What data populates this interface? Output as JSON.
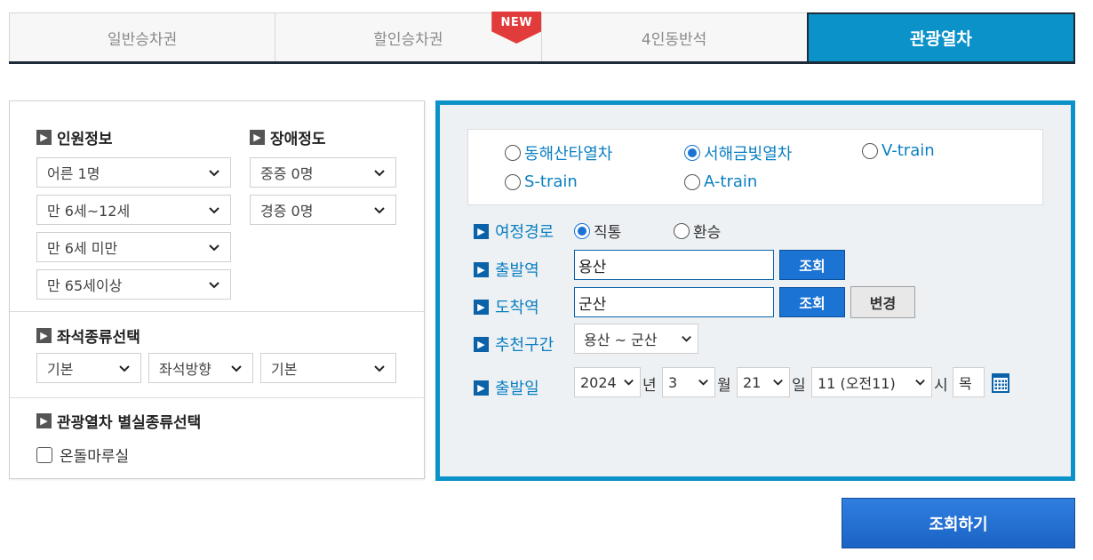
{
  "tabs": [
    {
      "label": "일반승차권",
      "active": false
    },
    {
      "label": "할인승차권",
      "active": false
    },
    {
      "label": "4인동반석",
      "active": false
    },
    {
      "label": "관광열차",
      "active": true
    }
  ],
  "new_badge": "NEW",
  "left": {
    "passenger_title": "인원정보",
    "disability_title": "장애정도",
    "passenger_selects": [
      "어른 1명",
      "만 6세~12세",
      "만 6세 미만",
      "만 65세이상"
    ],
    "disability_selects": [
      "중증 0명",
      "경증 0명"
    ],
    "seat_title": "좌석종류선택",
    "seat_selects": [
      "기본",
      "좌석방향",
      "기본"
    ],
    "room_title": "관광열차 별실종류선택",
    "room_option": "온돌마루실",
    "room_checked": false
  },
  "right": {
    "trains": [
      {
        "label": "동해산타열차",
        "checked": false
      },
      {
        "label": "서해금빛열차",
        "checked": true
      },
      {
        "label": "V-train",
        "checked": false
      },
      {
        "label": "S-train",
        "checked": false
      },
      {
        "label": "A-train",
        "checked": false
      }
    ],
    "route_label": "여정경로",
    "route_options": [
      {
        "label": "직통",
        "checked": true
      },
      {
        "label": "환승",
        "checked": false
      }
    ],
    "departure_label": "출발역",
    "departure_value": "용산",
    "arrival_label": "도착역",
    "arrival_value": "군산",
    "lookup_button": "조회",
    "change_button": "변경",
    "recommend_label": "추천구간",
    "recommend_value": "용산 ~ 군산",
    "date_label": "출발일",
    "year": "2024",
    "year_unit": "년",
    "month": "3",
    "month_unit": "월",
    "day": "21",
    "day_unit": "일",
    "hour": "11 (오전11)",
    "hour_unit": "시",
    "weekday": "목"
  },
  "search_button": "조회하기",
  "colors": {
    "accent": "#0b92c8",
    "button_blue": "#1b73d3",
    "link_text": "#0b7fc1",
    "badge_red": "#e23b3b"
  }
}
